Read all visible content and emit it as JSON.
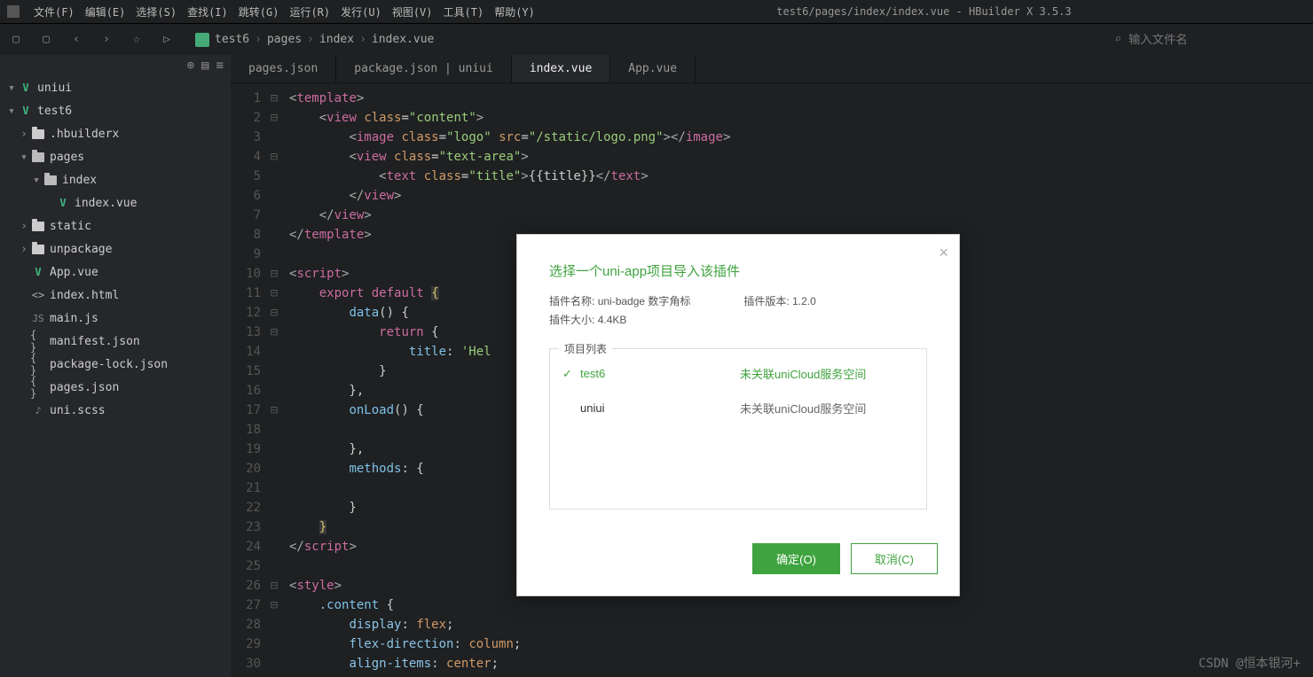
{
  "window_title": "test6/pages/index/index.vue - HBuilder X 3.5.3",
  "menubar": [
    "文件(F)",
    "编辑(E)",
    "选择(S)",
    "查找(I)",
    "跳转(G)",
    "运行(R)",
    "发行(U)",
    "视图(V)",
    "工具(T)",
    "帮助(Y)"
  ],
  "search_placeholder": "输入文件名",
  "breadcrumb": [
    "test6",
    "pages",
    "index",
    "index.vue"
  ],
  "tree": [
    {
      "depth": 0,
      "chev": "▾",
      "icon": "vue",
      "label": "uniui"
    },
    {
      "depth": 0,
      "chev": "▾",
      "icon": "vue",
      "label": "test6"
    },
    {
      "depth": 1,
      "chev": "›",
      "icon": "folder",
      "label": ".hbuilderx"
    },
    {
      "depth": 1,
      "chev": "▾",
      "icon": "folder-open",
      "label": "pages"
    },
    {
      "depth": 2,
      "chev": "▾",
      "icon": "folder-open",
      "label": "index"
    },
    {
      "depth": 3,
      "chev": "",
      "icon": "vue",
      "label": "index.vue"
    },
    {
      "depth": 1,
      "chev": "›",
      "icon": "folder",
      "label": "static"
    },
    {
      "depth": 1,
      "chev": "›",
      "icon": "folder",
      "label": "unpackage"
    },
    {
      "depth": 1,
      "chev": "",
      "icon": "vue",
      "label": "App.vue"
    },
    {
      "depth": 1,
      "chev": "",
      "icon": "html",
      "label": "index.html"
    },
    {
      "depth": 1,
      "chev": "",
      "icon": "js",
      "label": "main.js"
    },
    {
      "depth": 1,
      "chev": "",
      "icon": "json",
      "label": "manifest.json"
    },
    {
      "depth": 1,
      "chev": "",
      "icon": "json",
      "label": "package-lock.json"
    },
    {
      "depth": 1,
      "chev": "",
      "icon": "json",
      "label": "pages.json"
    },
    {
      "depth": 1,
      "chev": "",
      "icon": "scss",
      "label": "uni.scss"
    }
  ],
  "tabs": [
    {
      "label": "pages.json",
      "active": false
    },
    {
      "label": "package.json | uniui",
      "active": false
    },
    {
      "label": "index.vue",
      "active": true
    },
    {
      "label": "App.vue",
      "active": false
    }
  ],
  "code_lines": [
    {
      "n": 1,
      "f": "⊟",
      "html": "<span class='t-punc'>&lt;</span><span class='t-tag'>template</span><span class='t-punc'>&gt;</span>"
    },
    {
      "n": 2,
      "f": "⊟",
      "html": "    <span class='t-punc'>&lt;</span><span class='t-tag'>view</span> <span class='t-attr'>class</span>=<span class='t-str'>\"content\"</span><span class='t-punc'>&gt;</span>"
    },
    {
      "n": 3,
      "f": "",
      "html": "        <span class='t-punc'>&lt;</span><span class='t-tag'>image</span> <span class='t-attr'>class</span>=<span class='t-str'>\"logo\"</span> <span class='t-attr'>src</span>=<span class='t-str'>\"/static/logo.png\"</span><span class='t-punc'>&gt;&lt;/</span><span class='t-tag'>image</span><span class='t-punc'>&gt;</span>"
    },
    {
      "n": 4,
      "f": "⊟",
      "html": "        <span class='t-punc'>&lt;</span><span class='t-tag'>view</span> <span class='t-attr'>class</span>=<span class='t-str'>\"text-area\"</span><span class='t-punc'>&gt;</span>"
    },
    {
      "n": 5,
      "f": "",
      "html": "            <span class='t-punc'>&lt;</span><span class='t-tag'>text</span> <span class='t-attr'>class</span>=<span class='t-str'>\"title\"</span><span class='t-punc'>&gt;</span>{{title}}<span class='t-punc'>&lt;/</span><span class='t-tag'>text</span><span class='t-punc'>&gt;</span>"
    },
    {
      "n": 6,
      "f": "",
      "html": "        <span class='t-punc'>&lt;/</span><span class='t-tag'>view</span><span class='t-punc'>&gt;</span>"
    },
    {
      "n": 7,
      "f": "",
      "html": "    <span class='t-punc'>&lt;/</span><span class='t-tag'>view</span><span class='t-punc'>&gt;</span>"
    },
    {
      "n": 8,
      "f": "",
      "html": "<span class='t-punc'>&lt;/</span><span class='t-tag'>template</span><span class='t-punc'>&gt;</span>"
    },
    {
      "n": 9,
      "f": "",
      "html": " "
    },
    {
      "n": 10,
      "f": "⊟",
      "html": "<span class='t-punc'>&lt;</span><span class='t-tag'>script</span><span class='t-punc'>&gt;</span>"
    },
    {
      "n": 11,
      "f": "⊟",
      "html": "    <span class='t-kw'>export</span> <span class='t-kw'>default</span> <span class='t-brace box-hl'>{</span>"
    },
    {
      "n": 12,
      "f": "⊟",
      "html": "        <span class='t-id'>data</span>() {"
    },
    {
      "n": 13,
      "f": "⊟",
      "html": "            <span class='t-kw'>return</span> {"
    },
    {
      "n": 14,
      "f": "",
      "html": "                <span class='t-id'>title</span>: <span class='t-str'>'Hel</span>"
    },
    {
      "n": 15,
      "f": "",
      "html": "            }"
    },
    {
      "n": 16,
      "f": "",
      "html": "        },"
    },
    {
      "n": 17,
      "f": "⊟",
      "html": "        <span class='t-id'>onLoad</span>() {"
    },
    {
      "n": 18,
      "f": "",
      "html": " "
    },
    {
      "n": 19,
      "f": "",
      "html": "        },"
    },
    {
      "n": 20,
      "f": "",
      "html": "        <span class='t-id'>methods</span>: {"
    },
    {
      "n": 21,
      "f": "",
      "html": " "
    },
    {
      "n": 22,
      "f": "",
      "html": "        }"
    },
    {
      "n": 23,
      "f": "",
      "html": "    <span class='t-brace box-hl'>}</span>"
    },
    {
      "n": 24,
      "f": "",
      "html": "<span class='t-punc'>&lt;/</span><span class='t-tag'>script</span><span class='t-punc'>&gt;</span>"
    },
    {
      "n": 25,
      "f": "",
      "html": " "
    },
    {
      "n": 26,
      "f": "⊟",
      "html": "<span class='t-punc'>&lt;</span><span class='t-tag'>style</span><span class='t-punc'>&gt;</span>"
    },
    {
      "n": 27,
      "f": "⊟",
      "html": "    <span class='t-id'>.content</span> {"
    },
    {
      "n": 28,
      "f": "",
      "html": "        <span class='t-prop'>display</span>: <span class='t-val'>flex</span>;"
    },
    {
      "n": 29,
      "f": "",
      "html": "        <span class='t-prop'>flex-direction</span>: <span class='t-val'>column</span>;"
    },
    {
      "n": 30,
      "f": "",
      "html": "        <span class='t-prop'>align-items</span>: <span class='t-val'>center</span>;"
    }
  ],
  "dialog": {
    "title": "选择一个uni-app项目导入该插件",
    "plugin_name_label": "插件名称:",
    "plugin_name": "uni-badge 数字角标",
    "plugin_version_label": "插件版本:",
    "plugin_version": "1.2.0",
    "plugin_size_label": "插件大小:",
    "plugin_size": "4.4KB",
    "project_list_label": "项目列表",
    "projects": [
      {
        "name": "test6",
        "status": "未关联uniCloud服务空间",
        "selected": true
      },
      {
        "name": "uniui",
        "status": "未关联uniCloud服务空间",
        "selected": false
      }
    ],
    "ok": "确定(O)",
    "cancel": "取消(C)"
  },
  "watermark": "CSDN @恒本银河+"
}
